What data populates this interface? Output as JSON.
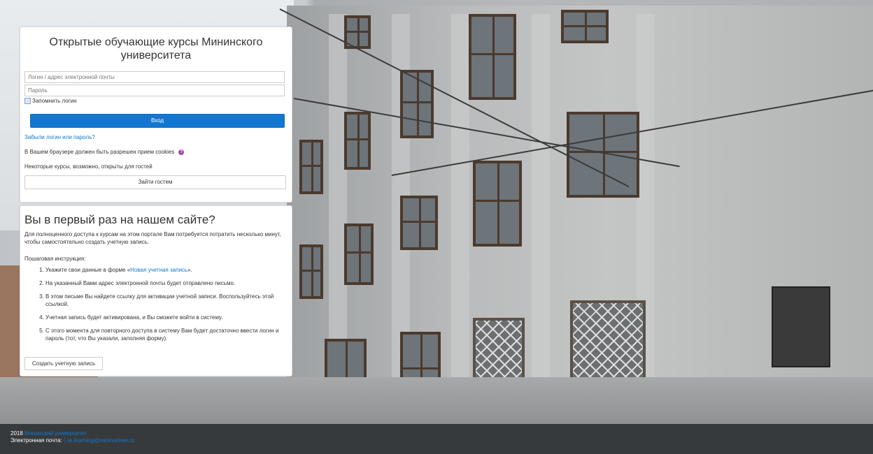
{
  "login": {
    "title": "Открытые обучающие курсы Мининского университета",
    "username_placeholder": "Логин / адрес электронной почты",
    "password_placeholder": "Пароль",
    "remember_label": "Запомнить логин",
    "login_button": "Вход",
    "forgot_link": "Забыли логин или пароль?",
    "cookies_notice": "В Вашем браузере должен быть разрешен прием cookies",
    "guests_notice": "Некоторые курсы, возможно, открыты для гостей",
    "guest_button": "Зайти гостем"
  },
  "signup": {
    "heading": "Вы в первый раз на нашем сайте?",
    "intro": "Для полноценного доступа к курсам на этом портале Вам потребуется потратить несколько минут, чтобы самостоятельно создать учетную запись.",
    "steps_title": "Пошаговая инструкция:",
    "step1_prefix": "Укажите свои данные в форме «",
    "step1_link": "Новая учетная запись",
    "step1_suffix": "».",
    "step2": "На указанный Вами адрес электронной почты будет отправлено письмо.",
    "step3": "В этом письме Вы найдете ссылку для активации учетной записи. Воспользуйтесь этой ссылкой.",
    "step4": "Учетная запись будет активирована, и Вы сможете войти в систему.",
    "step5": "С этого момента для повторного доступа в систему Вам будет достаточно ввести логин и пароль (тот, что Вы указали, заполняя форму).",
    "create_button": "Создать учетную запись"
  },
  "footer": {
    "year": "2018",
    "university_link": "Мининский университет",
    "email_label": "Электронная почта:",
    "email_value": "(-)e.learning@mininuniver.ru"
  },
  "colors": {
    "accent": "#1177d1",
    "footer_bg": "#373a3c",
    "help_icon": "#9b4ba3"
  },
  "icons": {
    "help": "question-circle-icon"
  }
}
